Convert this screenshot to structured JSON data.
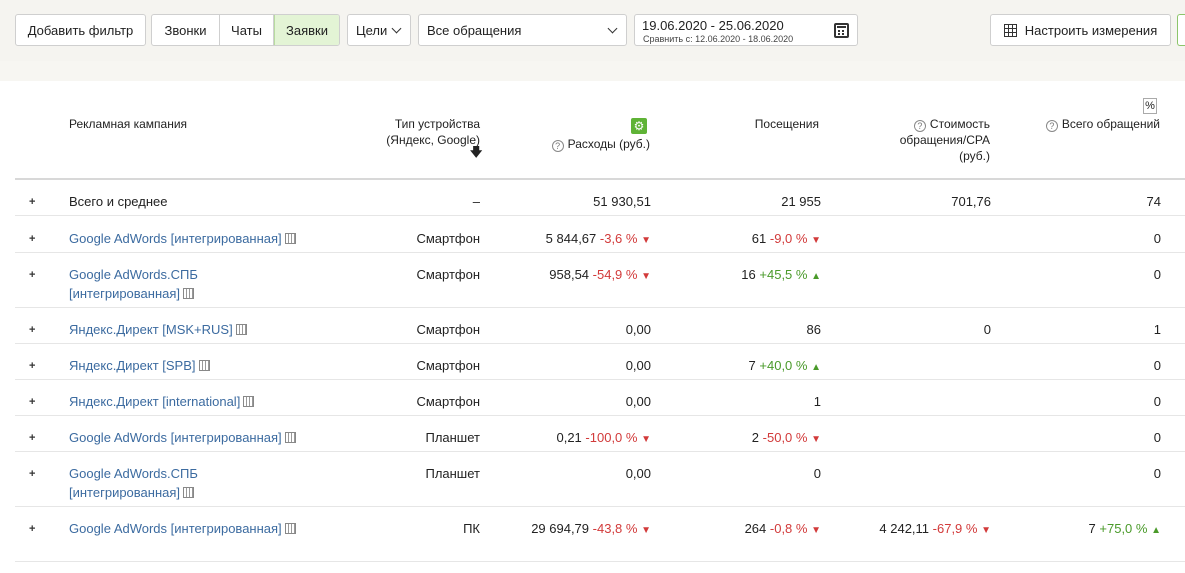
{
  "toolbar": {
    "add_filter": "Добавить фильтр",
    "segments": [
      "Звонки",
      "Чаты",
      "Заявки"
    ],
    "goals": "Цели",
    "requests_select": "Все обращения",
    "date_range": "19.06.2020 - 25.06.2020",
    "compare_range": "Сравнить с: 12.06.2020 - 18.06.2020",
    "configure": "Настроить измерения"
  },
  "table": {
    "headers": {
      "campaign": "Рекламная кампания",
      "device": "Тип устройства (Яндекс, Google)",
      "expenses": "Расходы (руб.)",
      "visits": "Посещения",
      "cost": "Стоимость обращения/CPA (руб.)",
      "total": "Всего обращений",
      "percent_toggle": "%"
    },
    "rows": [
      {
        "campaign": "Всего и среднее",
        "device": "–",
        "expenses": "51 930,51",
        "exp_delta": "",
        "visits": "21 955",
        "vis_delta": "",
        "cost": "701,76",
        "cost_delta": "",
        "total": "74",
        "total_delta": ""
      },
      {
        "campaign": "Google AdWords [интегрированная]",
        "device": "Смартфон",
        "expenses": "5 844,67",
        "exp_delta": "-3,6 %",
        "visits": "61",
        "vis_delta": "-9,0 %",
        "cost": "",
        "cost_delta": "",
        "total": "0",
        "total_delta": ""
      },
      {
        "campaign": "Google AdWords.СПБ [интегрированная]",
        "device": "Смартфон",
        "expenses": "958,54",
        "exp_delta": "-54,9 %",
        "visits": "16",
        "vis_delta": "+45,5 %",
        "cost": "",
        "cost_delta": "",
        "total": "0",
        "total_delta": ""
      },
      {
        "campaign": "Яндекс.Директ [MSK+RUS]",
        "device": "Смартфон",
        "expenses": "0,00",
        "exp_delta": "",
        "visits": "86",
        "vis_delta": "",
        "cost": "0",
        "cost_delta": "",
        "total": "1",
        "total_delta": ""
      },
      {
        "campaign": "Яндекс.Директ [SPB]",
        "device": "Смартфон",
        "expenses": "0,00",
        "exp_delta": "",
        "visits": "7",
        "vis_delta": "+40,0 %",
        "cost": "",
        "cost_delta": "",
        "total": "0",
        "total_delta": ""
      },
      {
        "campaign": "Яндекс.Директ [international]",
        "device": "Смартфон",
        "expenses": "0,00",
        "exp_delta": "",
        "visits": "1",
        "vis_delta": "",
        "cost": "",
        "cost_delta": "",
        "total": "0",
        "total_delta": ""
      },
      {
        "campaign": "Google AdWords [интегрированная]",
        "device": "Планшет",
        "expenses": "0,21",
        "exp_delta": "-100,0 %",
        "visits": "2",
        "vis_delta": "-50,0 %",
        "cost": "",
        "cost_delta": "",
        "total": "0",
        "total_delta": ""
      },
      {
        "campaign": "Google AdWords.СПБ [интегрированная]",
        "device": "Планшет",
        "expenses": "0,00",
        "exp_delta": "",
        "visits": "0",
        "vis_delta": "",
        "cost": "",
        "cost_delta": "",
        "total": "0",
        "total_delta": ""
      },
      {
        "campaign": "Google AdWords [интегрированная]",
        "device": "ПК",
        "expenses": "29 694,79",
        "exp_delta": "-43,8 %",
        "visits": "264",
        "vis_delta": "-0,8 %",
        "cost": "4 242,11",
        "cost_delta": "-67,9 %",
        "total": "7",
        "total_delta": "+75,0 %"
      }
    ]
  }
}
